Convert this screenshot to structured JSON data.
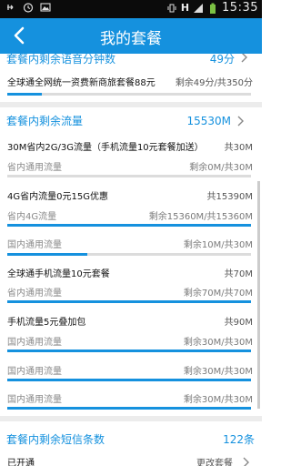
{
  "status": {
    "time": "15:35",
    "network": "H"
  },
  "header": {
    "title": "我的套餐"
  },
  "voice": {
    "title": "套餐内剩余语音分钟数",
    "value": "49分",
    "plan": "全球通全网统一资费新商旅套餐88元",
    "remaining": "剩余49分/共350分",
    "level": 0.14
  },
  "data": {
    "title": "套餐内剩余流量",
    "value": "15530M",
    "items": [
      {
        "name": "30M省内2G/3G流量（手机流量10元套餐加送）",
        "total": "共30M",
        "sub": "省内通用流量",
        "remaining": "剩余0M/共30M",
        "level": 0
      },
      {
        "name": "4G省内流量0元15G优惠",
        "total": "共15390M",
        "sub": "省内4G流量",
        "remaining": "剩余15360M/共15360M",
        "level": 1
      },
      {
        "name": "",
        "total": "",
        "sub": "国内通用流量",
        "remaining": "剩余10M/共30M",
        "level": 0.33
      },
      {
        "name": "全球通手机流量10元套餐",
        "total": "共70M",
        "sub": "省内通用流量",
        "remaining": "剩余70M/共70M",
        "level": 1
      },
      {
        "name": "手机流量5元叠加包",
        "total": "共90M",
        "sub": "国内通用流量",
        "remaining": "剩余30M/共30M",
        "level": 1
      },
      {
        "name": "",
        "total": "",
        "sub": "国内通用流量",
        "remaining": "剩余30M/共30M",
        "level": 1
      },
      {
        "name": "",
        "total": "",
        "sub": "国内通用流量",
        "remaining": "剩余30M/共30M",
        "level": 1
      }
    ]
  },
  "sms": {
    "title": "套餐内剩余短信条数",
    "value": "122条",
    "status": "已开通",
    "more": "更改套餐"
  }
}
